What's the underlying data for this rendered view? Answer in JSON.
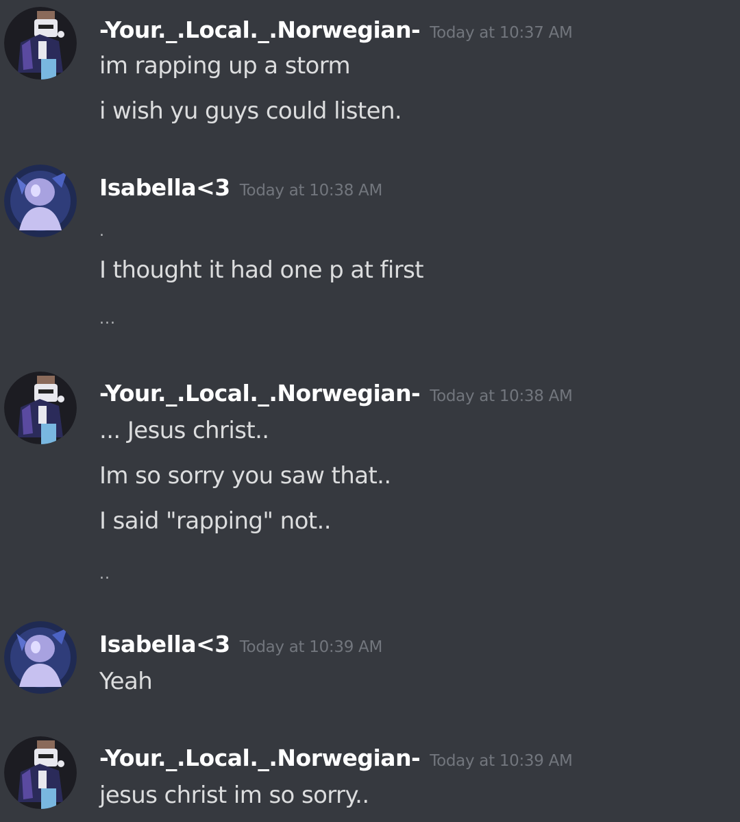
{
  "messages": [
    {
      "author": "-Your._.Local._.Norwegian-",
      "timestamp": "Today at 10:37 AM",
      "avatar_icon": "jacket-character-avatar-icon",
      "lines": [
        "im rapping up a storm",
        "i wish yu guys could listen."
      ]
    },
    {
      "author": "Isabella<3",
      "timestamp": "Today at 10:38 AM",
      "avatar_icon": "purple-creature-avatar-icon",
      "lines": [
        ".",
        "I thought it had one p at first",
        "..."
      ]
    },
    {
      "author": "-Your._.Local._.Norwegian-",
      "timestamp": "Today at 10:38 AM",
      "avatar_icon": "jacket-character-avatar-icon",
      "lines": [
        "... Jesus christ..",
        "Im so sorry you saw that..",
        "I said \"rapping\" not..",
        ".."
      ]
    },
    {
      "author": "Isabella<3",
      "timestamp": "Today at 10:39 AM",
      "avatar_icon": "purple-creature-avatar-icon",
      "lines": [
        "Yeah"
      ]
    },
    {
      "author": "-Your._.Local._.Norwegian-",
      "timestamp": "Today at 10:39 AM",
      "avatar_icon": "jacket-character-avatar-icon",
      "lines": [
        "jesus christ im so sorry.."
      ]
    }
  ],
  "colors": {
    "background": "#36393f",
    "username": "#ffffff",
    "timestamp": "#72767d",
    "message_text": "#dcddde"
  }
}
